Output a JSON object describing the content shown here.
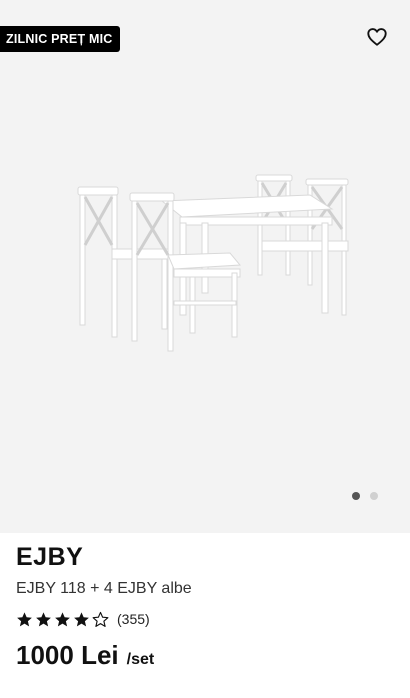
{
  "badge": {
    "label": "ZILNIC PREȚ MIC"
  },
  "icons": {
    "favorite": "heart-outline-icon",
    "rating_full": "star-filled-icon",
    "rating_empty": "star-outline-icon"
  },
  "carousel": {
    "slides": 2,
    "active_index": 0
  },
  "product": {
    "name": "EJBY",
    "subtitle": "EJBY 118 + 4 EJBY albe",
    "rating": {
      "stars": 4,
      "max": 5,
      "count_label": "(355)"
    },
    "price": "1000 Lei",
    "price_unit": "/set"
  },
  "colors": {
    "badge_bg": "#000000",
    "media_bg": "#f3f3f3",
    "active_dot": "#555555",
    "inactive_dot": "#d0d0d0"
  }
}
